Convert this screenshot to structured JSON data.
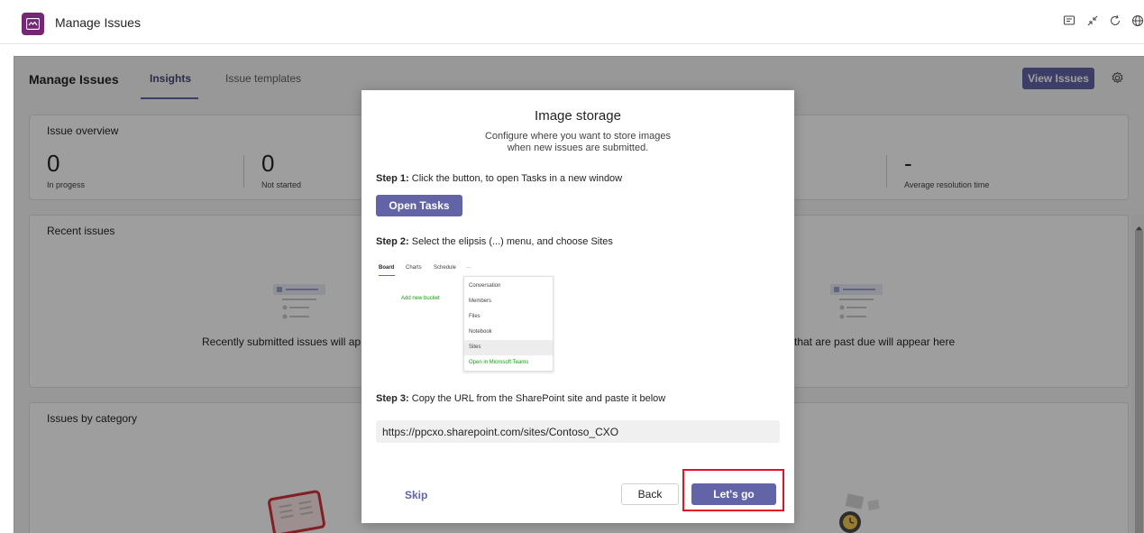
{
  "titlebar": {
    "title": "Manage Issues",
    "icons": [
      "chat-icon",
      "collapse-icon",
      "refresh-icon",
      "globe-icon"
    ]
  },
  "app": {
    "name": "Manage Issues",
    "tabs": [
      {
        "label": "Insights",
        "active": true
      },
      {
        "label": "Issue templates",
        "active": false
      }
    ],
    "view_issues_label": "View Issues"
  },
  "overview": {
    "title": "Issue overview",
    "metrics": [
      {
        "value": "0",
        "label": "In progess"
      },
      {
        "value": "0",
        "label": "Not started"
      },
      {
        "value": "-",
        "label": "Average resolution time"
      }
    ]
  },
  "recent": {
    "title": "Recent issues",
    "empty_left": "Recently submitted issues will appe",
    "empty_right": "that are past due will appear here"
  },
  "bycat": {
    "title": "Issues by category"
  },
  "dialog": {
    "title": "Image storage",
    "subtitle_line1": "Configure where you want to store images",
    "subtitle_line2": "when new issues are submitted.",
    "step1_label": "Step 1:",
    "step1_text": " Click the button, to open Tasks in a new window",
    "open_tasks_label": "Open Tasks",
    "step2_label": "Step 2:",
    "step2_text": " Select the elipsis (...) menu, and choose Sites",
    "mock": {
      "tabs": [
        "Board",
        "Charts",
        "Schedule",
        "···"
      ],
      "add_bucket": "Add new bucket",
      "menu_items": [
        "Conversation",
        "Members",
        "Files",
        "Notebook",
        "Sites",
        "Open in Microsoft Teams"
      ]
    },
    "step3_label": "Step 3:",
    "step3_text": " Copy the URL from the SharePoint site and paste it below",
    "url_value": "https://ppcxo.sharepoint.com/sites/Contoso_CXO",
    "skip_label": "Skip",
    "back_label": "Back",
    "letsgo_label": "Let's go"
  },
  "colors": {
    "accent": "#6264a7",
    "app_logo": "#742774",
    "highlight": "#e81123"
  }
}
